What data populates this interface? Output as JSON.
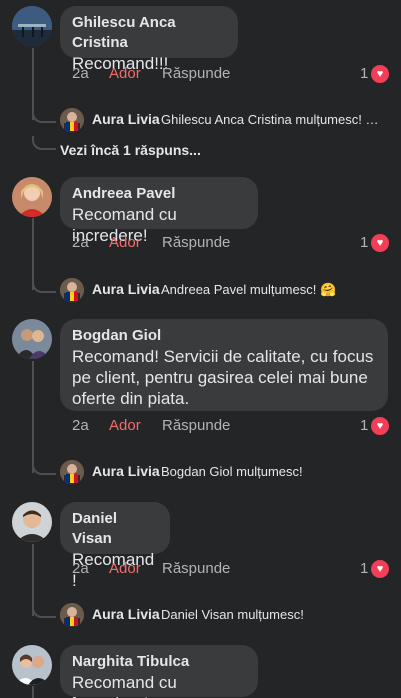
{
  "comments": [
    {
      "author": "Ghilescu Anca Cristina",
      "text": "Recomand!!!",
      "time": "2a",
      "like": "Ador",
      "reply": "Răspunde",
      "reactions": "1",
      "reply_preview": {
        "author": "Aura Livia",
        "text": "Ghilescu Anca Cristina mulțumesc! …"
      },
      "more_replies": "Vezi încă 1 răspuns..."
    },
    {
      "author": "Andreea Pavel",
      "text": "Recomand cu incredere!",
      "time": "2a",
      "like": "Ador",
      "reply": "Răspunde",
      "reactions": "1",
      "reply_preview": {
        "author": "Aura Livia",
        "text": "Andreea Pavel mulțumesc! 🤗"
      }
    },
    {
      "author": "Bogdan Giol",
      "text_lines": [
        "Recomand! Servicii de calitate, cu focus",
        "pe client, pentru gasirea celei mai bune",
        "oferte din piata."
      ],
      "time": "2a",
      "like": "Ador",
      "reply": "Răspunde",
      "reactions": "1",
      "reply_preview": {
        "author": "Aura Livia",
        "text": "Bogdan Giol mulțumesc!"
      }
    },
    {
      "author": "Daniel Visan",
      "text": "Recomand !",
      "time": "2a",
      "like": "Ador",
      "reply": "Răspunde",
      "reactions": "1",
      "reply_preview": {
        "author": "Aura Livia",
        "text": "Daniel Visan  mulțumesc!"
      }
    },
    {
      "author": "Narghita Tibulca",
      "text": "Recomand cu încredere!"
    }
  ],
  "colors": {
    "background": "#242526",
    "bubble": "#3a3b3c",
    "like_active": "#f26d6b",
    "heart": "#f33e58",
    "muted_text": "#b0b3b8"
  },
  "icons": {
    "reaction": "heart-reaction-icon",
    "flag": "romania-flag-icon"
  }
}
